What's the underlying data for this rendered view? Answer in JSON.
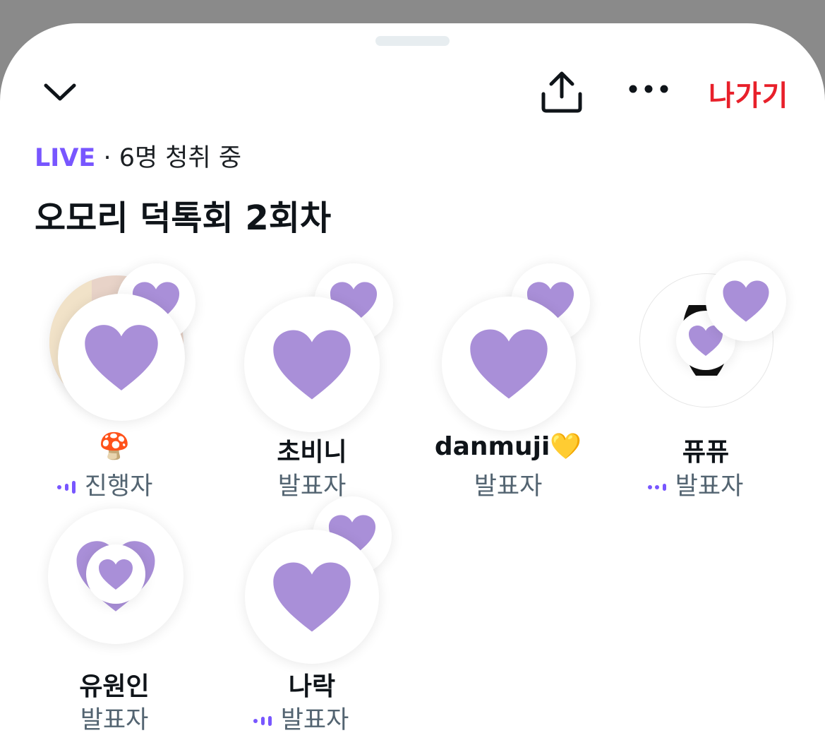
{
  "header": {
    "leave_label": "나가기"
  },
  "status": {
    "live": "LIVE",
    "separator": " · ",
    "listeners": "6명 청취 중"
  },
  "space_title": "오모리 덕톡회 2회차",
  "participants": [
    {
      "name": "🍄",
      "role": "진행자",
      "speaking": true
    },
    {
      "name": "초비니",
      "role": "발표자",
      "speaking": false
    },
    {
      "name": "danmuji💛",
      "role": "발표자",
      "speaking": false
    },
    {
      "name": "퓨퓨",
      "role": "발표자",
      "speaking": true
    },
    {
      "name": "유원인",
      "role": "발표자",
      "speaking": false
    },
    {
      "name": "나락",
      "role": "발표자",
      "speaking": true
    }
  ],
  "colors": {
    "accent": "#7856ff",
    "heart": "#a98fd8",
    "leave": "#e8202a"
  }
}
